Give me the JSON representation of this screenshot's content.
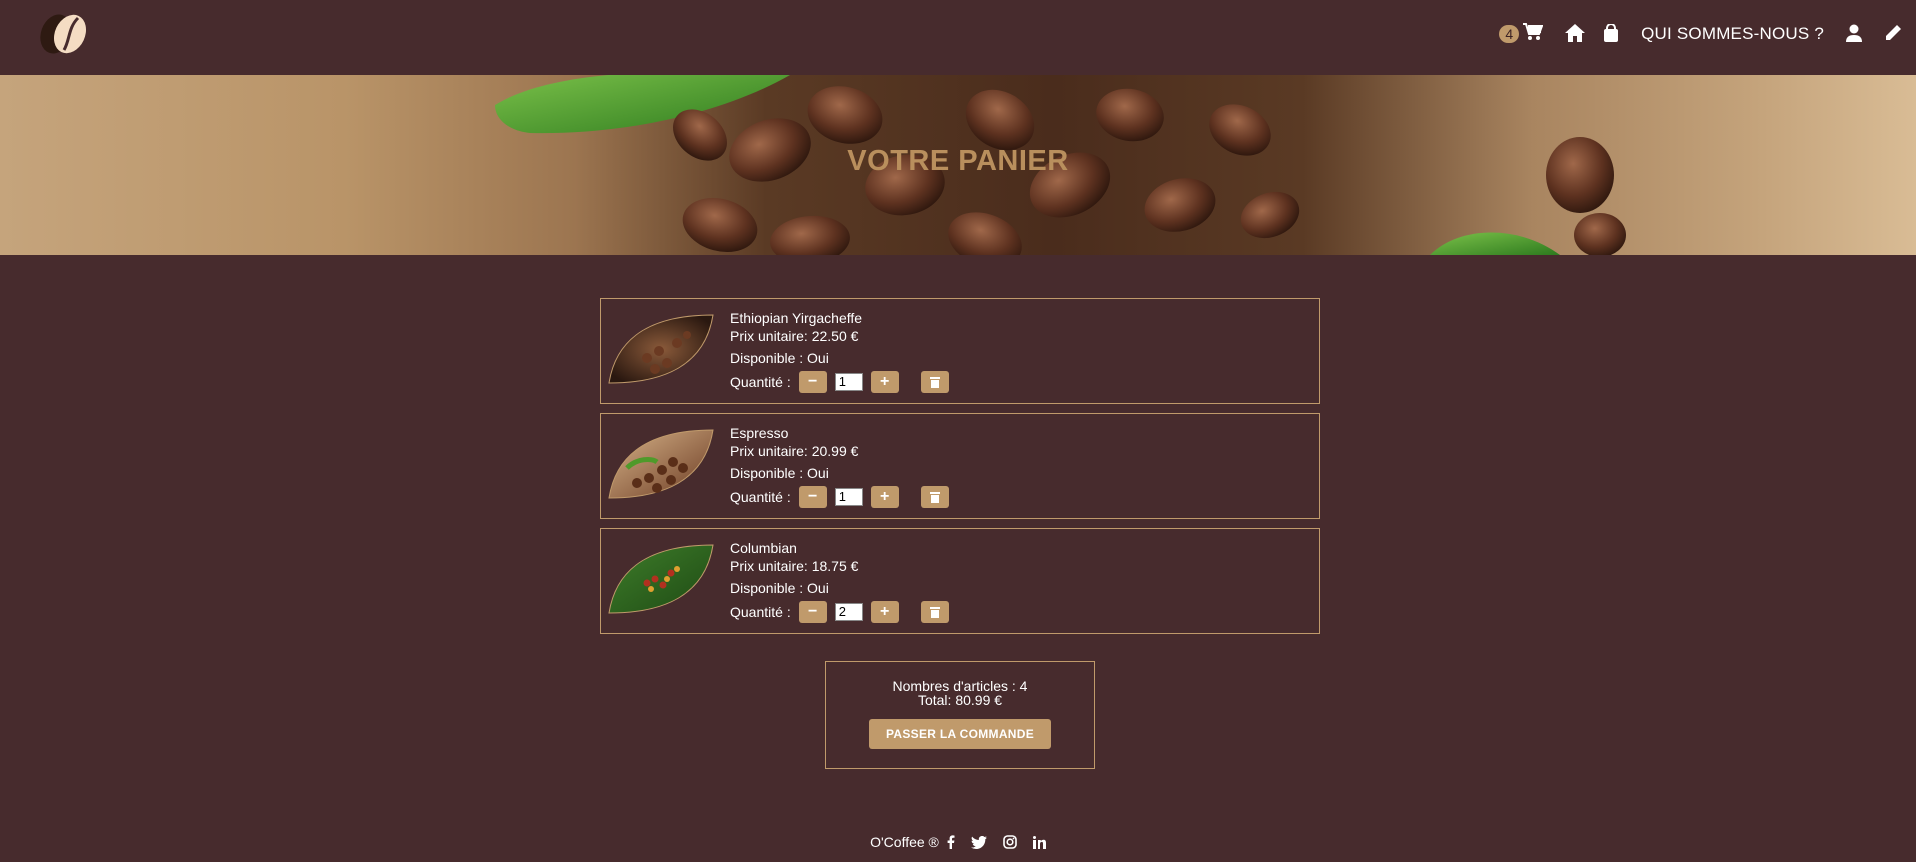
{
  "header": {
    "cart_count": "4",
    "nav_about": "QUI SOMMES-NOUS ?"
  },
  "hero": {
    "title": "VOTRE PANIER"
  },
  "cart": {
    "items": [
      {
        "name": "Ethiopian Yirgacheffe",
        "price": "Prix unitaire: 22.50 €",
        "available": "Disponible : Oui",
        "qty_label": "Quantité :",
        "qty": "1"
      },
      {
        "name": "Espresso",
        "price": "Prix unitaire: 20.99 €",
        "available": "Disponible : Oui",
        "qty_label": "Quantité :",
        "qty": "1"
      },
      {
        "name": "Columbian",
        "price": "Prix unitaire: 18.75 €",
        "available": "Disponible : Oui",
        "qty_label": "Quantité :",
        "qty": "2"
      }
    ]
  },
  "summary": {
    "count": "Nombres d'articles : 4",
    "total": "Total: 80.99 €",
    "order_button": "PASSER LA COMMANDE"
  },
  "footer": {
    "brand": "O'Coffee ®"
  },
  "colors": {
    "background": "#472b2d",
    "accent": "#c09a6b"
  }
}
